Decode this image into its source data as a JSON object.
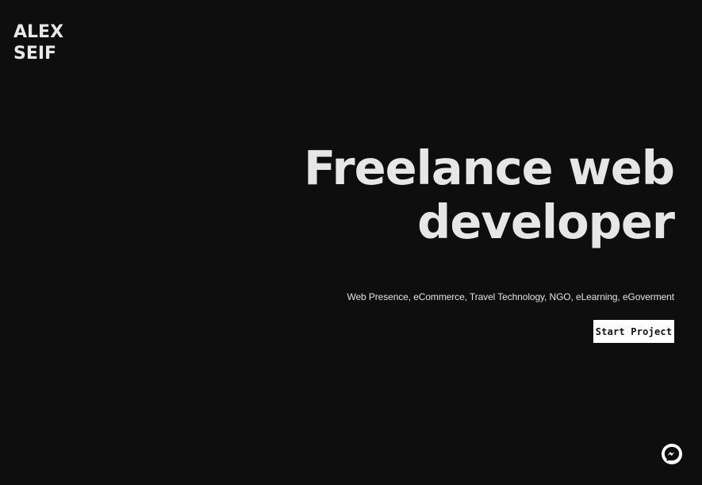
{
  "logo": {
    "line1": "ALEX",
    "line2": "SEIF"
  },
  "hero": {
    "title_line1": "Freelance web",
    "title_line2": "developer",
    "services": "Web Presence, eCommerce, Travel Technology, NGO, eLearning, eGoverment",
    "cta_label": "Start Project"
  },
  "chat_widget": {
    "icon": "messenger-icon"
  },
  "colors": {
    "background": "#0e0e0f",
    "text": "#e6e6e6",
    "button_bg": "#ffffff",
    "button_text": "#111111"
  }
}
